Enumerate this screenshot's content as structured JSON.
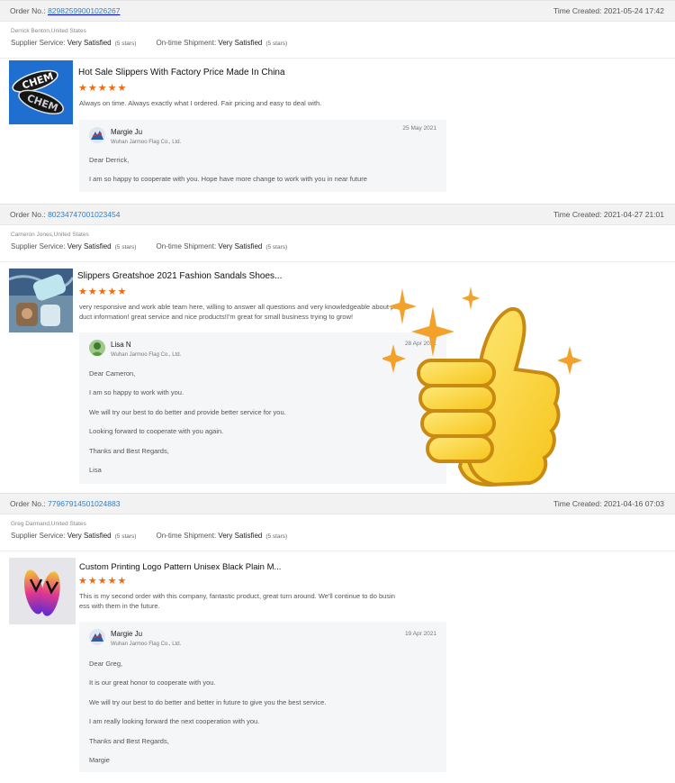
{
  "labels": {
    "order_no": "Order No.:",
    "time_created": "Time Created:",
    "supplier_service": "Supplier Service:",
    "ontime_shipment": "On-time Shipment:"
  },
  "orders": [
    {
      "order_no": "82982599001026267",
      "time_created": "2021-05-24 17:42",
      "buyer": "Derrick Benton,United States",
      "supplier_service": "Very Satisfied",
      "supplier_stars": "(5 stars)",
      "shipment": "Very Satisfied",
      "shipment_stars": "(5 stars)",
      "product_title": "Hot Sale Slippers With Factory Price Made In China",
      "rating": 5,
      "comment": [
        "Always on time. Always exactly what I ordered. Fair pricing and easy to deal with."
      ],
      "reply": {
        "name": "Margie Ju",
        "company": "Wuhan Jarmoo Flag Co., Ltd.",
        "date": "25 May 2021",
        "lines": [
          "Dear Derrick,",
          "I am so happy to cooperate with you. Hope have more change to work with you in near future"
        ]
      }
    },
    {
      "order_no": "80234747001023454",
      "time_created": "2021-04-27 21:01",
      "buyer": "Cameron Jones,United States",
      "supplier_service": "Very Satisfied",
      "supplier_stars": "(5 stars)",
      "shipment": "Very Satisfied",
      "shipment_stars": "(5 stars)",
      "product_title": "Slippers Greatshoe 2021 Fashion Sandals Shoes...",
      "rating": 5,
      "comment": [
        "very responsive and work able team here, willing to answer all questions and very knowledgeable about pro",
        "duct information! great service and nice products!I'm great for small business trying to grow!"
      ],
      "reply": {
        "name": "Lisa N",
        "company": "Wuhan Jarmoo Flag Co., Ltd.",
        "date": "28 Apr 2021",
        "lines": [
          "Dear Cameron,",
          "I am so happy to work with you.",
          "We will try our best to do better and provide better service for you.",
          "Looking forward to cooperate with you again.",
          "Thanks and Best Regards,",
          "Lisa"
        ]
      }
    },
    {
      "order_no": "77967914501024883",
      "time_created": "2021-04-16 07:03",
      "buyer": "Greg Darmand,United States",
      "supplier_service": "Very Satisfied",
      "supplier_stars": "(5 stars)",
      "shipment": "Very Satisfied",
      "shipment_stars": "(5 stars)",
      "product_title": "Custom Printing Logo Pattern Unisex Black Plain M...",
      "rating": 5,
      "comment": [
        "This is my second order with this company, fantastic product, great turn around. We'll continue to do busin",
        "ess with them in the future."
      ],
      "reply": {
        "name": "Margie Ju",
        "company": "Wuhan Jarmoo Flag Co., Ltd.",
        "date": "19 Apr 2021",
        "lines": [
          "Dear Greg,",
          "It is our great honor to cooperate with you.",
          "We will try our best to do better and better in future to give you the best service.",
          "I am really looking forward the next cooperation with you.",
          "Thanks and Best Regards,",
          "Margie"
        ]
      }
    }
  ],
  "colors": {
    "link": "#2f80c9",
    "star": "#f26a10",
    "header_bg": "#f2f2f2",
    "reply_bg": "#f5f6f8"
  },
  "overlay": {
    "icon": "thumbs-up-sparkles"
  }
}
